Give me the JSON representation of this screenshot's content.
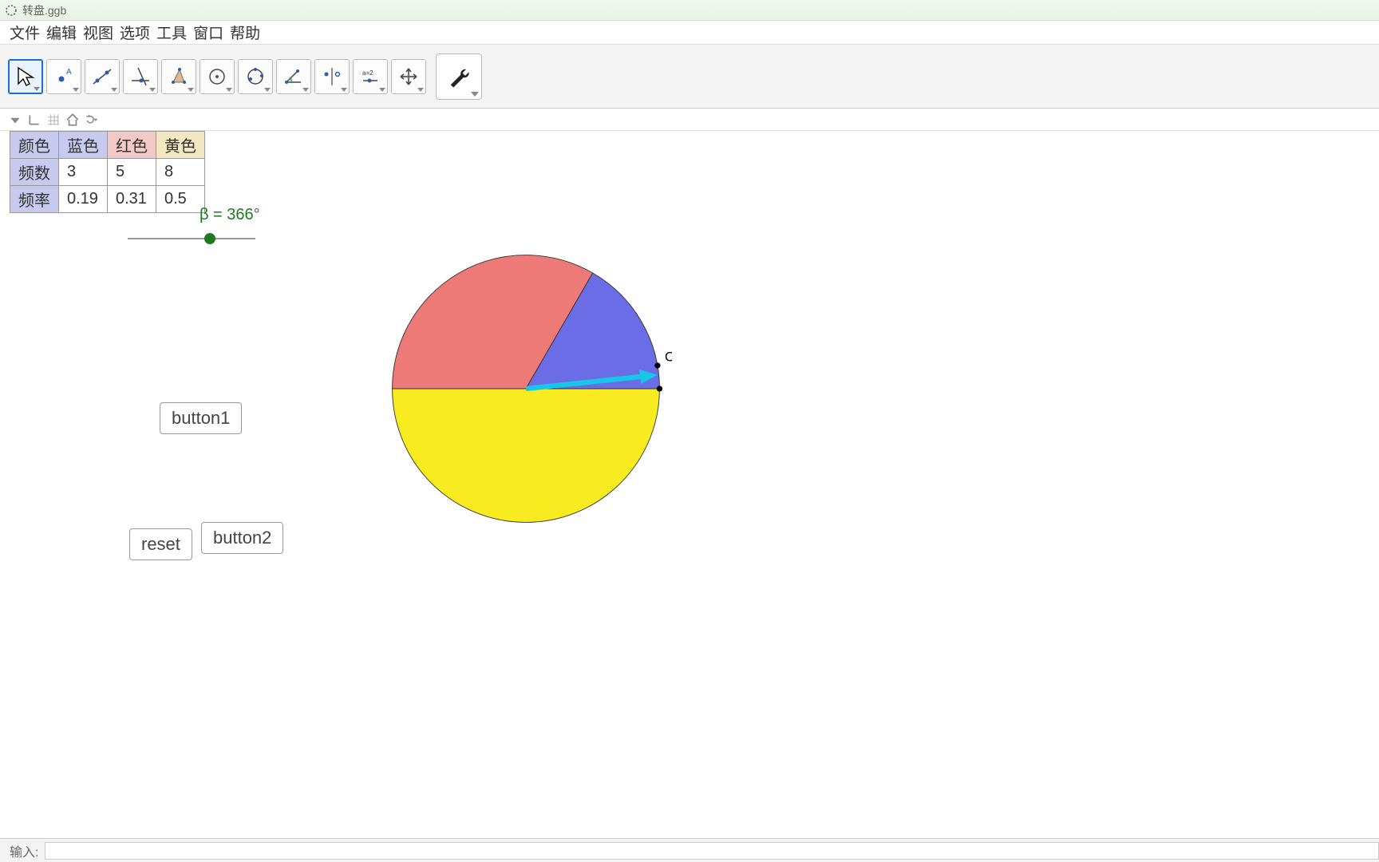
{
  "window": {
    "title": "转盘.ggb"
  },
  "menu": {
    "items": [
      "文件",
      "编辑",
      "视图",
      "选项",
      "工具",
      "窗口",
      "帮助"
    ]
  },
  "toolbar": {
    "tools": [
      {
        "name": "move-tool",
        "selected": true
      },
      {
        "name": "point-tool"
      },
      {
        "name": "line-tool"
      },
      {
        "name": "perpendicular-tool"
      },
      {
        "name": "polygon-tool"
      },
      {
        "name": "circle-tool"
      },
      {
        "name": "conic-tool"
      },
      {
        "name": "angle-tool"
      },
      {
        "name": "reflect-tool"
      },
      {
        "name": "slider-tool"
      },
      {
        "name": "move-view-tool"
      }
    ],
    "options_tool": "options-tool"
  },
  "secondbar": {
    "icons": [
      "style-dropdown",
      "axes-toggle",
      "grid-toggle",
      "home-icon",
      "undo-dropdown"
    ]
  },
  "table": {
    "headers": {
      "color": "颜色",
      "blue": "蓝色",
      "red": "红色",
      "yellow": "黄色"
    },
    "rows": {
      "freq_label": "频数",
      "freq": [
        "3",
        "5",
        "8"
      ],
      "rate_label": "频率",
      "rate": [
        "0.19",
        "0.31",
        "0.5"
      ]
    }
  },
  "slider": {
    "label": "β = 366°",
    "value": 366,
    "min": 0,
    "max": 600
  },
  "buttons": {
    "b1": "button1",
    "b2": "button2",
    "reset": "reset"
  },
  "chart_data": {
    "type": "pie",
    "categories": [
      "红色",
      "蓝色",
      "黄色"
    ],
    "values": [
      120,
      60,
      180
    ],
    "colors": [
      "#EE7A78",
      "#6B6DE6",
      "#F8EB1F"
    ],
    "title": "",
    "pointer_angle_deg": 6,
    "pointer_color": "#17C6E8",
    "point_label": "C"
  },
  "inputbar": {
    "label": "输入:"
  }
}
